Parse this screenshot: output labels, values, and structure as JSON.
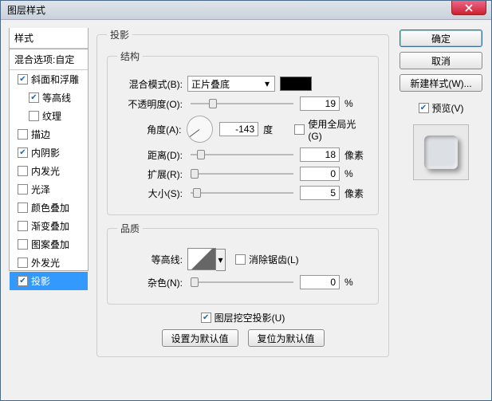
{
  "window": {
    "title": "图层样式"
  },
  "buttons": {
    "ok": "确定",
    "cancel": "取消",
    "newstyle": "新建样式(W)...",
    "setdefault": "设置为默认值",
    "resetdefault": "复位为默认值"
  },
  "preview": {
    "label": "预览(V)",
    "checked": true
  },
  "sidebar": {
    "header1": "样式",
    "header2": "混合选项:自定",
    "items": [
      {
        "label": "斜面和浮雕",
        "checked": true,
        "indent": 0
      },
      {
        "label": "等高线",
        "checked": true,
        "indent": 1
      },
      {
        "label": "纹理",
        "checked": false,
        "indent": 1
      },
      {
        "label": "描边",
        "checked": false,
        "indent": 0
      },
      {
        "label": "内阴影",
        "checked": true,
        "indent": 0
      },
      {
        "label": "内发光",
        "checked": false,
        "indent": 0
      },
      {
        "label": "光泽",
        "checked": false,
        "indent": 0
      },
      {
        "label": "颜色叠加",
        "checked": false,
        "indent": 0
      },
      {
        "label": "渐变叠加",
        "checked": false,
        "indent": 0
      },
      {
        "label": "图案叠加",
        "checked": false,
        "indent": 0
      },
      {
        "label": "外发光",
        "checked": false,
        "indent": 0
      },
      {
        "label": "投影",
        "checked": true,
        "indent": 0,
        "selected": true
      }
    ]
  },
  "panel": {
    "title": "投影",
    "structure": {
      "legend": "结构",
      "blendmode_label": "混合模式(B):",
      "blendmode_value": "正片叠底",
      "opacity_label": "不透明度(O):",
      "opacity_value": "19",
      "opacity_unit": "%",
      "angle_label": "角度(A):",
      "angle_value": "-143",
      "angle_unit": "度",
      "globallight_label": "使用全局光(G)",
      "globallight_checked": false,
      "distance_label": "距离(D):",
      "distance_value": "18",
      "distance_unit": "像素",
      "spread_label": "扩展(R):",
      "spread_value": "0",
      "spread_unit": "%",
      "size_label": "大小(S):",
      "size_value": "5",
      "size_unit": "像素"
    },
    "quality": {
      "legend": "品质",
      "contour_label": "等高线:",
      "antialias_label": "消除锯齿(L)",
      "antialias_checked": false,
      "noise_label": "杂色(N):",
      "noise_value": "0",
      "noise_unit": "%"
    },
    "knockout": {
      "label": "图层挖空投影(U)",
      "checked": true
    }
  }
}
